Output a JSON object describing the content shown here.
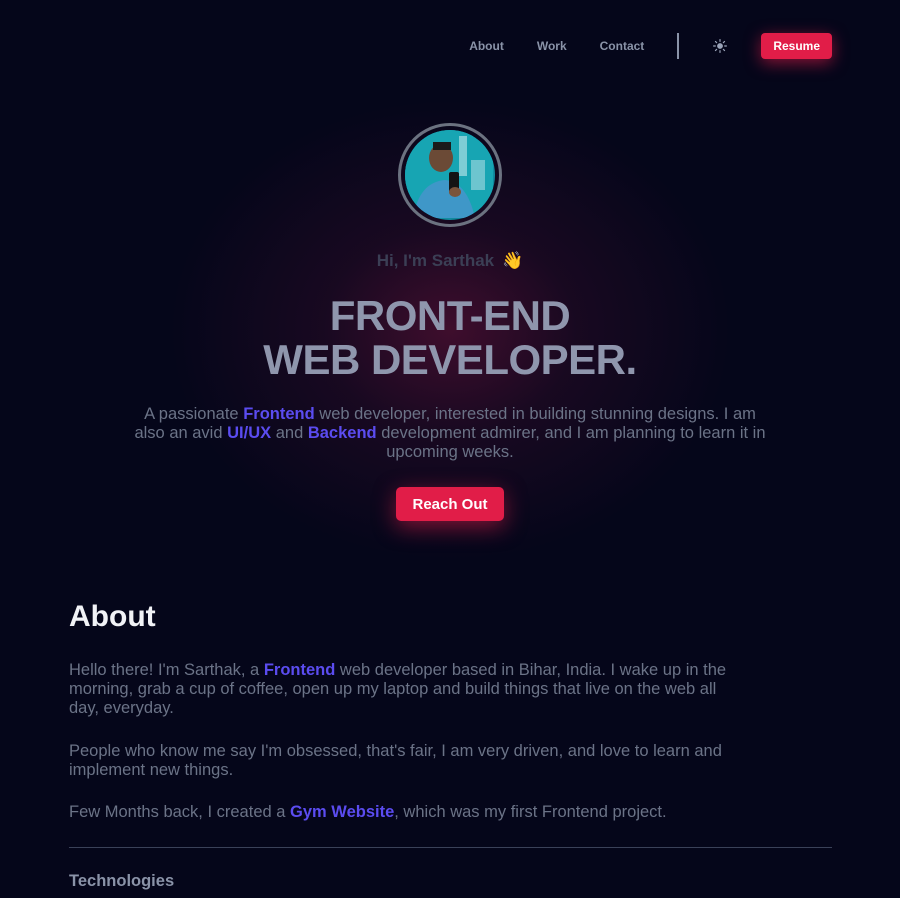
{
  "nav": {
    "links": [
      "About",
      "Work",
      "Contact"
    ],
    "theme_icon": "sun-icon",
    "resume_label": "Resume"
  },
  "hero": {
    "greeting": "Hi, I'm Sarthak",
    "wave_emoji": "👋",
    "headline_line1": "FRONT-END",
    "headline_line2": "WEB DEVELOPER.",
    "intro": {
      "t1": "A passionate ",
      "h1": "Frontend",
      "t2": " web developer, interested in building stunning designs. I am also an avid ",
      "h2": "UI/UX",
      "t3": " and ",
      "h3": "Backend",
      "t4": " development admirer, and I am planning to learn it in upcoming weeks."
    },
    "cta_label": "Reach Out"
  },
  "about": {
    "title": "About",
    "p1": {
      "t1": "Hello there! I'm Sarthak, a ",
      "h1": "Frontend",
      "t2": " web developer based in Bihar, India. I wake up in the morning, grab a cup of coffee, open up my laptop and build things that live on the web all day, everyday."
    },
    "p2": "People who know me say I'm obsessed, that's fair, I am very driven, and love to learn and implement new things.",
    "p3": {
      "t1": "Few Months back, I created a ",
      "h1": "Gym Website",
      "t2": ", which was my first Frontend project."
    },
    "technologies_title": "Technologies"
  },
  "colors": {
    "background": "#05061a",
    "accent": "#e11d48",
    "highlight": "#5b4cf0",
    "text_muted": "#6b7387"
  }
}
